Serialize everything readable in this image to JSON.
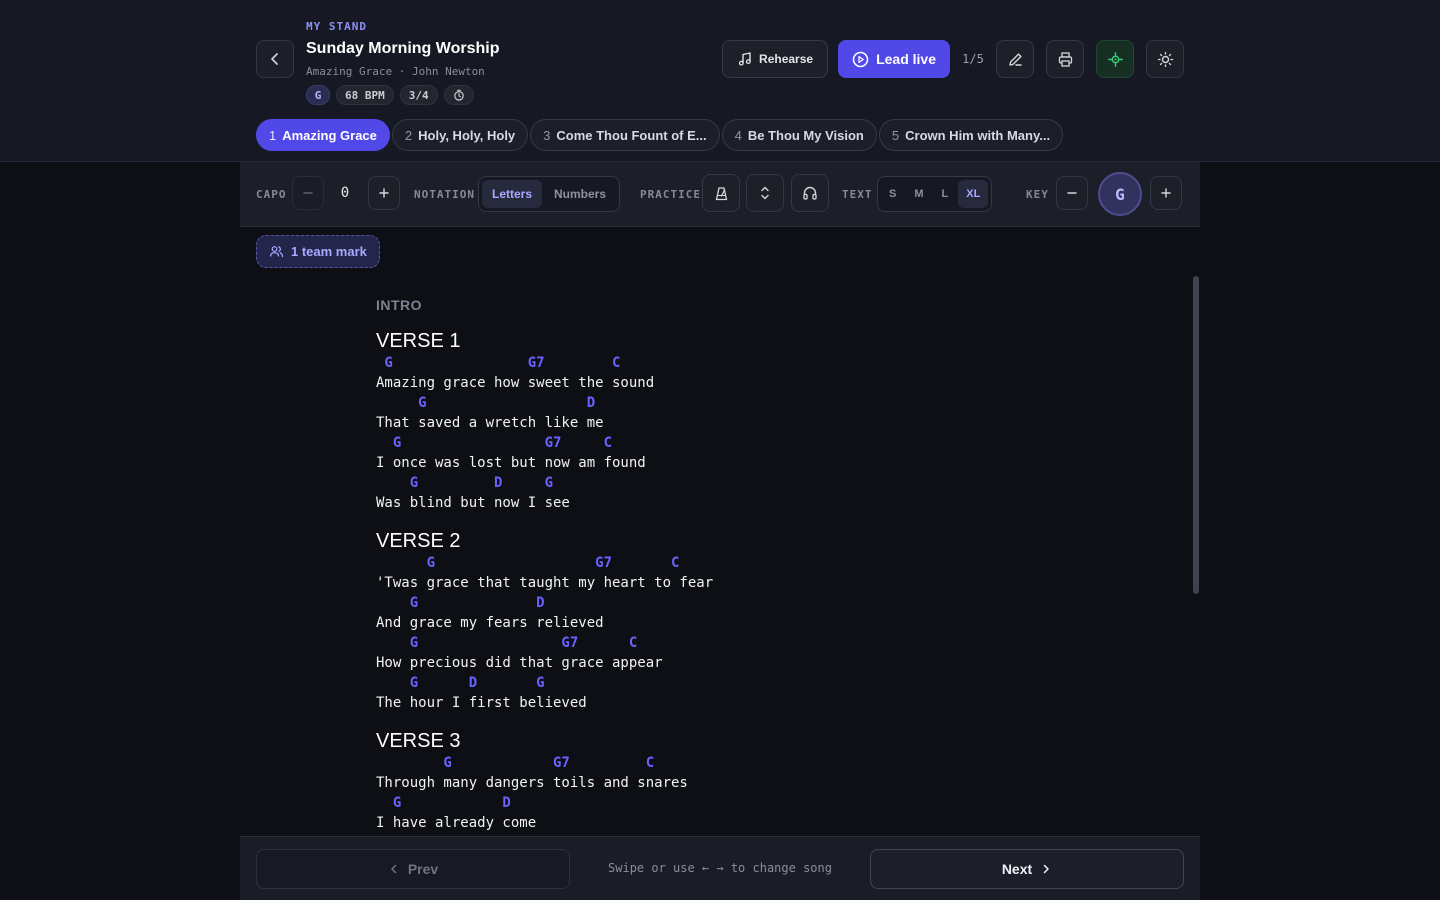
{
  "header": {
    "eyebrow": "MY STAND",
    "title": "Sunday Morning Worship",
    "subtitle": "Amazing Grace · John Newton",
    "meta": {
      "key": "G",
      "bpm": "68 BPM",
      "time": "3/4"
    },
    "rehearse_label": "Rehearse",
    "lead_label": "Lead live",
    "position": "1/5"
  },
  "songs": [
    {
      "num": "1",
      "title": "Amazing Grace"
    },
    {
      "num": "2",
      "title": "Holy, Holy, Holy"
    },
    {
      "num": "3",
      "title": "Come Thou Fount of E..."
    },
    {
      "num": "4",
      "title": "Be Thou My Vision"
    },
    {
      "num": "5",
      "title": "Crown Him with Many..."
    }
  ],
  "toolbar": {
    "capo_label": "CAPO",
    "capo_value": "0",
    "notation_label": "NOTATION",
    "notation_options": [
      "Letters",
      "Numbers"
    ],
    "practice_label": "PRACTICE",
    "text_label": "TEXT",
    "text_sizes": [
      "S",
      "M",
      "L",
      "XL"
    ],
    "key_label": "KEY",
    "key_value": "G"
  },
  "team_mark": "1 team mark",
  "sheet": {
    "intro": "INTRO",
    "sections": [
      {
        "name": "VERSE 1",
        "lines": [
          {
            "chords": " G                G7        C",
            "lyric": "Amazing grace how sweet the sound"
          },
          {
            "chords": "     G                   D",
            "lyric": "That saved a wretch like me"
          },
          {
            "chords": "  G                 G7     C",
            "lyric": "I once was lost but now am found"
          },
          {
            "chords": "    G         D     G",
            "lyric": "Was blind but now I see"
          }
        ]
      },
      {
        "name": "VERSE 2",
        "lines": [
          {
            "chords": "      G                   G7       C",
            "lyric": "'Twas grace that taught my heart to fear"
          },
          {
            "chords": "    G              D",
            "lyric": "And grace my fears relieved"
          },
          {
            "chords": "    G                 G7      C",
            "lyric": "How precious did that grace appear"
          },
          {
            "chords": "    G      D       G",
            "lyric": "The hour I first believed"
          }
        ]
      },
      {
        "name": "VERSE 3",
        "lines": [
          {
            "chords": "        G            G7         C",
            "lyric": "Through many dangers toils and snares"
          },
          {
            "chords": "  G            D",
            "lyric": "I have already come"
          }
        ]
      }
    ]
  },
  "footer": {
    "prev_label": "Prev",
    "next_label": "Next",
    "hint": "Swipe or use ← → to change song"
  },
  "colors": {
    "accent": "#5148e8",
    "chord": "#6a62ff",
    "background": "#0d0f15",
    "header_bg": "#161923"
  },
  "icons": {
    "back": "chevron-left-icon",
    "rehearse": "music-note-icon",
    "lead": "play-circle-icon",
    "edit": "pencil-icon",
    "print": "printer-icon",
    "focus": "crosshair-icon",
    "theme": "sun-icon",
    "tempo": "stopwatch-icon",
    "metronome": "metronome-icon",
    "autoscroll": "chevrons-up-down-icon",
    "audio": "headphones-icon",
    "team": "users-icon"
  }
}
